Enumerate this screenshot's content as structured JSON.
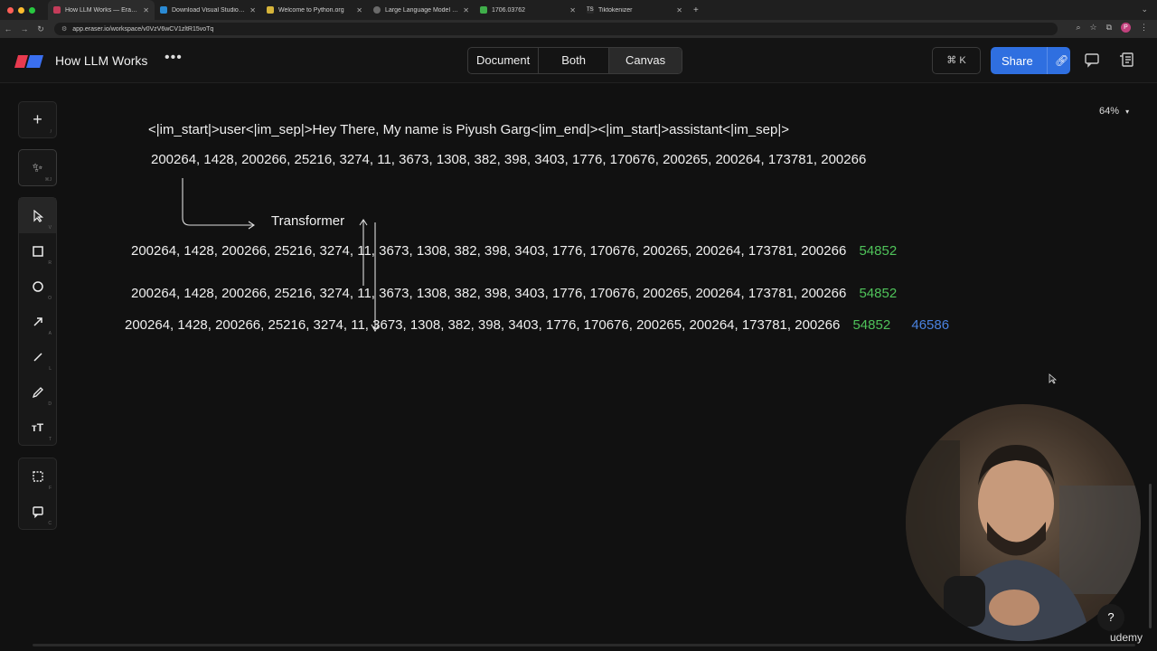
{
  "browser": {
    "tabs": [
      {
        "title": "How LLM Works — Eraser",
        "active": true
      },
      {
        "title": "Download Visual Studio Code"
      },
      {
        "title": "Welcome to Python.org"
      },
      {
        "title": "Large Language Model Overv"
      },
      {
        "title": "1706.03762"
      },
      {
        "title": "Tiktokenizer"
      }
    ],
    "url": "app.eraser.io/workspace/v0VzV6wCV1zltR15voTq"
  },
  "app": {
    "title": "How LLM Works",
    "view_modes": [
      "Document",
      "Both",
      "Canvas"
    ],
    "active_view": "Canvas",
    "command_shortcut": "⌘ K",
    "share_label": "Share"
  },
  "toolbar": {
    "add_key": "/",
    "ai_key": "⌘J",
    "tools": [
      {
        "name": "select",
        "key": "V"
      },
      {
        "name": "rectangle",
        "key": "R"
      },
      {
        "name": "ellipse",
        "key": "O"
      },
      {
        "name": "arrow",
        "key": "A"
      },
      {
        "name": "line",
        "key": "L"
      },
      {
        "name": "pencil",
        "key": "D"
      },
      {
        "name": "text",
        "key": "T"
      }
    ],
    "frame_key": "F",
    "comment_key": "C"
  },
  "canvas": {
    "zoom": "64%",
    "prompt_text": "<|im_start|>user<|im_sep|>Hey There, My name is Piyush Garg<|im_end|><|im_start|>assistant<|im_sep|>",
    "tokens_line": "200264, 1428, 200266, 25216, 3274, 11, 3673, 1308, 382, 398, 3403, 1776, 170676, 200265, 200264, 173781, 200266",
    "transformer_label": "Transformer",
    "row1_tokens": "200264, 1428, 200266, 25216, 3274, 11, 3673, 1308, 382, 398, 3403, 1776, 170676, 200265, 200264, 173781, 200266",
    "row1_new": "54852",
    "row2_tokens": "200264, 1428, 200266, 25216, 3274, 11, 3673, 1308, 382, 398, 3403, 1776, 170676, 200265, 200264, 173781, 200266",
    "row2_new": "54852",
    "row3_tokens": "200264, 1428, 200266, 25216, 3274, 11, 3673, 1308, 382, 398, 3403, 1776, 170676, 200265, 200264, 173781, 200266",
    "row3_new1": "54852",
    "row3_new2": "46586"
  },
  "overlay": {
    "help": "?",
    "watermark": "udemy"
  },
  "colors": {
    "accent": "#2f6fe0",
    "green_token": "#4fc35a",
    "blue_token": "#4a82e0",
    "background": "#111111"
  }
}
